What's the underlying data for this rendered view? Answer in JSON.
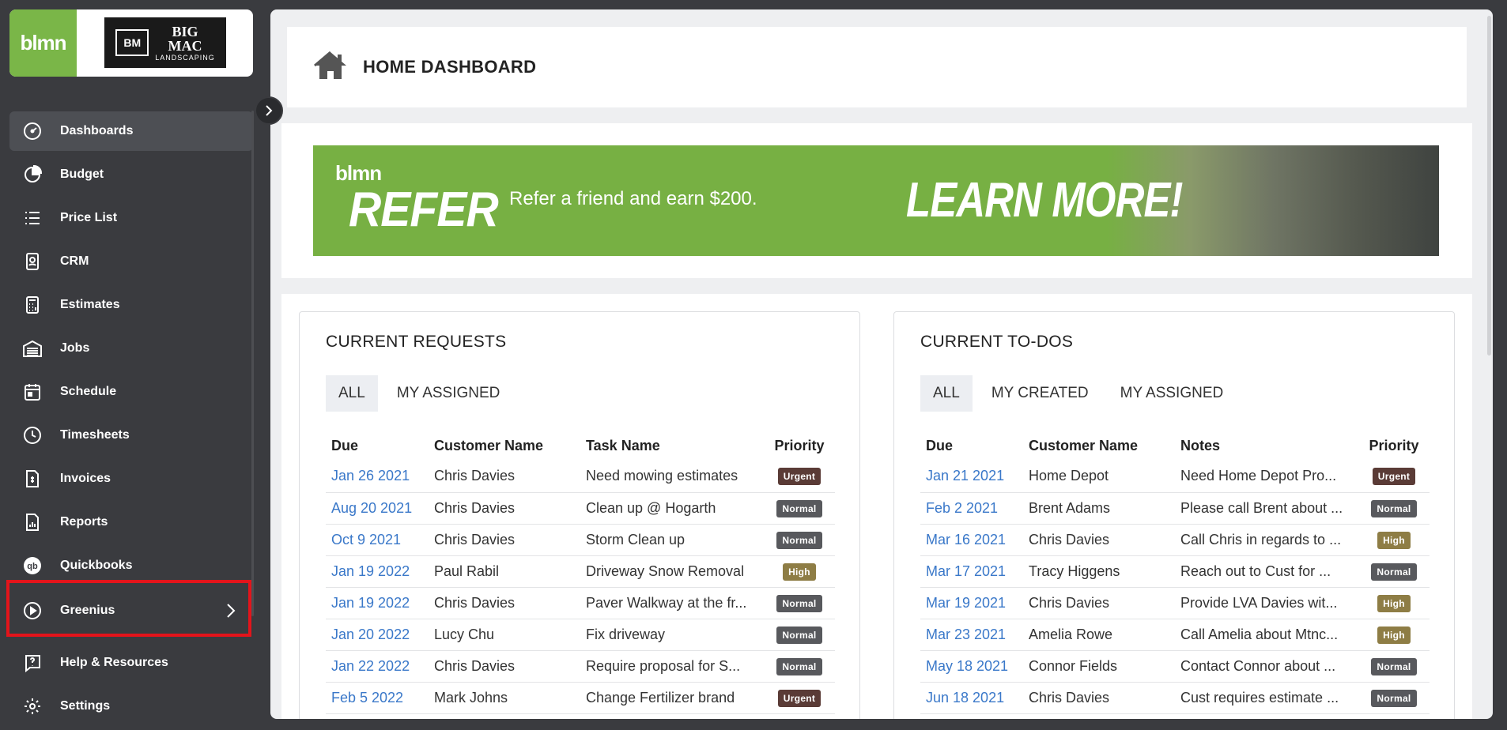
{
  "brand": {
    "lmn_logo": "blmn",
    "company_mark": "BM",
    "company_name_big": "BIG",
    "company_name_mac": "MAC",
    "company_tagline": "LANDSCAPING"
  },
  "sidebar": {
    "items": [
      {
        "label": "Dashboards",
        "icon": "gauge-icon"
      },
      {
        "label": "Budget",
        "icon": "pie-chart-icon"
      },
      {
        "label": "Price List",
        "icon": "list-icon"
      },
      {
        "label": "CRM",
        "icon": "contact-card-icon"
      },
      {
        "label": "Estimates",
        "icon": "calculator-icon"
      },
      {
        "label": "Jobs",
        "icon": "garage-icon"
      },
      {
        "label": "Schedule",
        "icon": "calendar-icon"
      },
      {
        "label": "Timesheets",
        "icon": "clock-icon"
      },
      {
        "label": "Invoices",
        "icon": "invoice-icon"
      },
      {
        "label": "Reports",
        "icon": "report-icon"
      },
      {
        "label": "Quickbooks",
        "icon": "quickbooks-icon"
      },
      {
        "label": "Greenius",
        "icon": "play-circle-icon"
      },
      {
        "label": "Help & Resources",
        "icon": "help-icon"
      },
      {
        "label": "Settings",
        "icon": "gear-icon"
      }
    ],
    "active": "Dashboards",
    "highlighted": "Greenius"
  },
  "header": {
    "title": "HOME DASHBOARD"
  },
  "banner": {
    "logo": "blmn",
    "title": "REFER",
    "tagline": "Refer a friend and earn $200.",
    "cta": "LEARN MORE!"
  },
  "requests": {
    "title": "CURRENT REQUESTS",
    "tabs": [
      "ALL",
      "MY ASSIGNED"
    ],
    "columns": [
      "Due",
      "Customer Name",
      "Task Name",
      "Priority"
    ],
    "rows": [
      {
        "due": "Jan 26 2021",
        "customer": "Chris Davies",
        "task": "Need mowing estimates",
        "priority": "Urgent"
      },
      {
        "due": "Aug 20 2021",
        "customer": "Chris Davies",
        "task": "Clean up @ Hogarth",
        "priority": "Normal"
      },
      {
        "due": "Oct 9 2021",
        "customer": "Chris Davies",
        "task": "Storm Clean up",
        "priority": "Normal"
      },
      {
        "due": "Jan 19 2022",
        "customer": "Paul Rabil",
        "task": "Driveway Snow Removal",
        "priority": "High"
      },
      {
        "due": "Jan 19 2022",
        "customer": "Chris Davies",
        "task": "Paver Walkway at the fr...",
        "priority": "Normal"
      },
      {
        "due": "Jan 20 2022",
        "customer": "Lucy Chu",
        "task": "Fix driveway",
        "priority": "Normal"
      },
      {
        "due": "Jan 22 2022",
        "customer": "Chris Davies",
        "task": "Require proposal for S...",
        "priority": "Normal"
      },
      {
        "due": "Feb 5 2022",
        "customer": "Mark Johns",
        "task": "Change Fertilizer brand",
        "priority": "Urgent"
      }
    ]
  },
  "todos": {
    "title": "CURRENT TO-DOS",
    "tabs": [
      "ALL",
      "MY CREATED",
      "MY ASSIGNED"
    ],
    "columns": [
      "Due",
      "Customer Name",
      "Notes",
      "Priority"
    ],
    "rows": [
      {
        "due": "Jan 21 2021",
        "customer": "Home Depot",
        "task": "Need Home Depot Pro...",
        "priority": "Urgent"
      },
      {
        "due": "Feb 2 2021",
        "customer": "Brent Adams",
        "task": "Please call Brent about ...",
        "priority": "Normal"
      },
      {
        "due": "Mar 16 2021",
        "customer": "Chris Davies",
        "task": "Call Chris in regards to ...",
        "priority": "High"
      },
      {
        "due": "Mar 17 2021",
        "customer": "Tracy Higgens",
        "task": "Reach out to Cust for ...",
        "priority": "Normal"
      },
      {
        "due": "Mar 19 2021",
        "customer": "Chris Davies",
        "task": "Provide LVA Davies wit...",
        "priority": "High"
      },
      {
        "due": "Mar 23 2021",
        "customer": "Amelia Rowe",
        "task": "Call Amelia about Mtnc...",
        "priority": "High"
      },
      {
        "due": "May 18 2021",
        "customer": "Connor Fields",
        "task": "Contact Connor about ...",
        "priority": "Normal"
      },
      {
        "due": "Jun 18 2021",
        "customer": "Chris Davies",
        "task": "Cust requires estimate ...",
        "priority": "Normal"
      }
    ]
  },
  "colors": {
    "brand_green": "#77b043",
    "link_blue": "#3a78c9",
    "highlight_red": "#e3141b"
  }
}
